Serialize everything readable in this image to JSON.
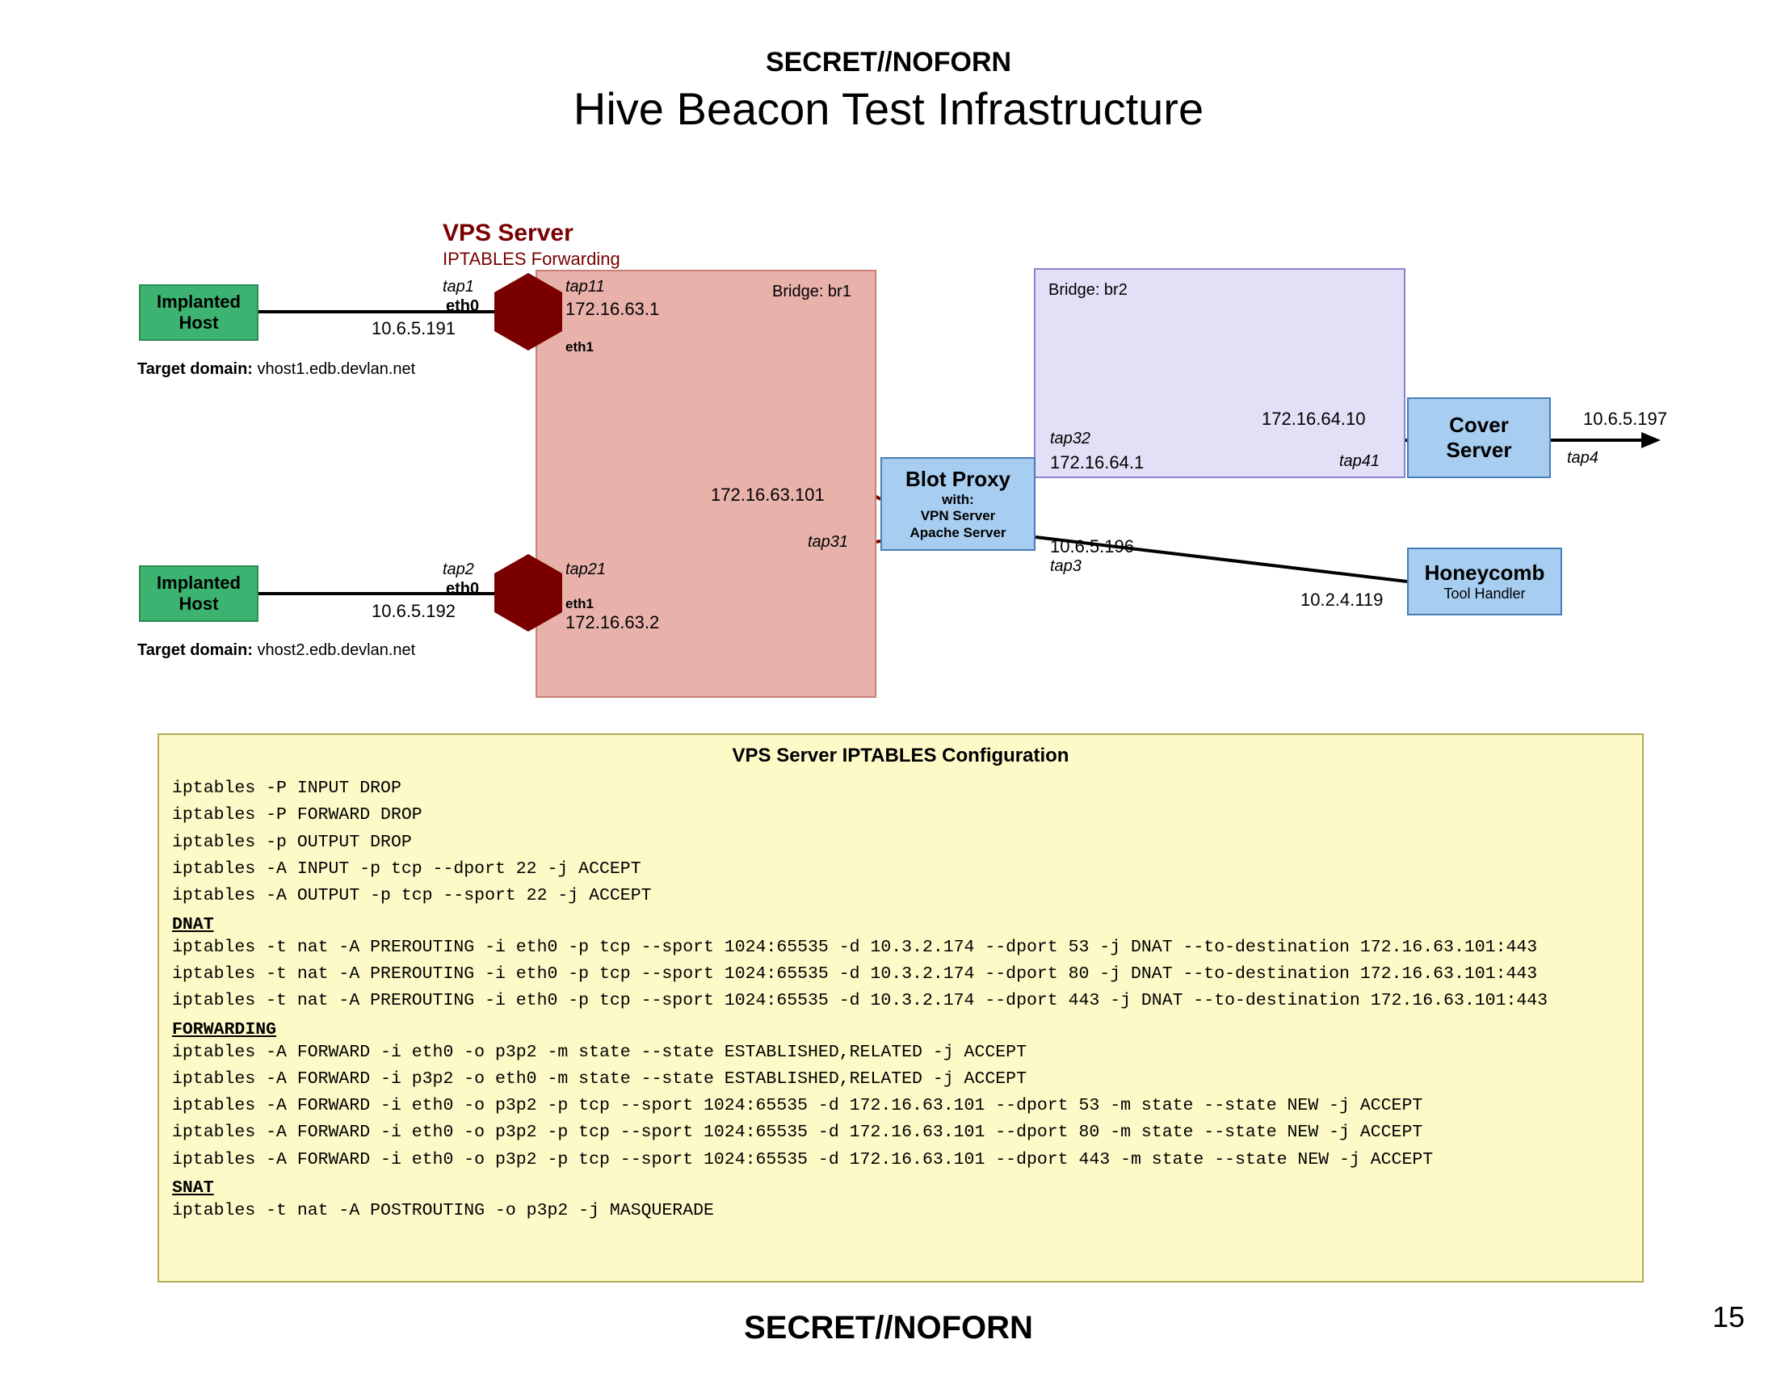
{
  "classification": "SECRET//NOFORN",
  "title": "Hive Beacon Test Infrastructure",
  "page_number": "15",
  "vps": {
    "heading": "VPS Server",
    "sub": "IPTABLES Forwarding",
    "br1_label": "Bridge: br1"
  },
  "br2_label": "Bridge: br2",
  "hosts": {
    "implanted": "Implanted",
    "host": "Host",
    "td_prefix": "Target domain: ",
    "td1": "vhost1.edb.devlan.net",
    "td2": "vhost2.edb.devlan.net"
  },
  "ips": {
    "h1": "10.6.5.191",
    "h2": "10.6.5.192",
    "vps1": "172.16.63.1",
    "vps2": "172.16.63.2",
    "blot_pink": "172.16.63.101",
    "blot_br2": "172.16.64.1",
    "cover_br2": "172.16.64.10",
    "honey_left": "10.6.5.196",
    "honey_right": "10.2.4.119",
    "cover_out": "10.6.5.197"
  },
  "taps": {
    "tap1": "tap1",
    "tap11": "tap11",
    "tap2": "tap2",
    "tap21": "tap21",
    "tap31": "tap31",
    "tap32": "tap32",
    "tap3": "tap3",
    "tap41": "tap41",
    "tap4": "tap4"
  },
  "eth": {
    "eth0": "eth0",
    "eth1": "eth1"
  },
  "blot": {
    "title": "Blot Proxy",
    "with": "with:",
    "line1": "VPN Server",
    "line2": "Apache Server"
  },
  "cover": {
    "title": "Cover",
    "sub": "Server"
  },
  "honey": {
    "title": "Honeycomb",
    "sub": "Tool Handler"
  },
  "iptables": {
    "title": "VPS Server IPTABLES Configuration",
    "lines_a": [
      "iptables -P INPUT DROP",
      "iptables -P FORWARD DROP",
      "iptables -p OUTPUT DROP",
      "iptables -A INPUT -p tcp --dport 22 -j ACCEPT",
      "iptables -A OUTPUT -p tcp --sport 22 -j ACCEPT"
    ],
    "sec_dnat": "DNAT",
    "lines_b": [
      "iptables -t nat -A PREROUTING -i eth0 -p tcp --sport 1024:65535 -d 10.3.2.174 --dport 53 -j DNAT --to-destination 172.16.63.101:443",
      "iptables -t nat -A PREROUTING -i eth0 -p tcp --sport 1024:65535 -d 10.3.2.174 --dport 80 -j DNAT --to-destination 172.16.63.101:443",
      "iptables -t nat -A PREROUTING -i eth0 -p tcp --sport 1024:65535 -d 10.3.2.174 --dport 443 -j DNAT --to-destination 172.16.63.101:443"
    ],
    "sec_fwd": "FORWARDING",
    "lines_c": [
      "iptables -A FORWARD -i eth0 -o p3p2 -m state --state ESTABLISHED,RELATED -j ACCEPT",
      "iptables -A FORWARD -i p3p2 -o eth0 -m state --state ESTABLISHED,RELATED -j ACCEPT",
      "iptables -A FORWARD -i eth0 -o p3p2 -p tcp --sport 1024:65535 -d 172.16.63.101 --dport 53 -m state --state NEW -j ACCEPT",
      "iptables -A FORWARD -i eth0 -o p3p2 -p tcp --sport 1024:65535 -d 172.16.63.101 --dport 80 -m state --state NEW -j ACCEPT",
      "iptables -A FORWARD -i eth0 -o p3p2 -p tcp --sport 1024:65535 -d 172.16.63.101 --dport 443 -m state --state NEW -j ACCEPT"
    ],
    "sec_snat": "SNAT",
    "lines_d": [
      "iptables -t nat -A POSTROUTING -o p3p2 -j MASQUERADE"
    ]
  }
}
